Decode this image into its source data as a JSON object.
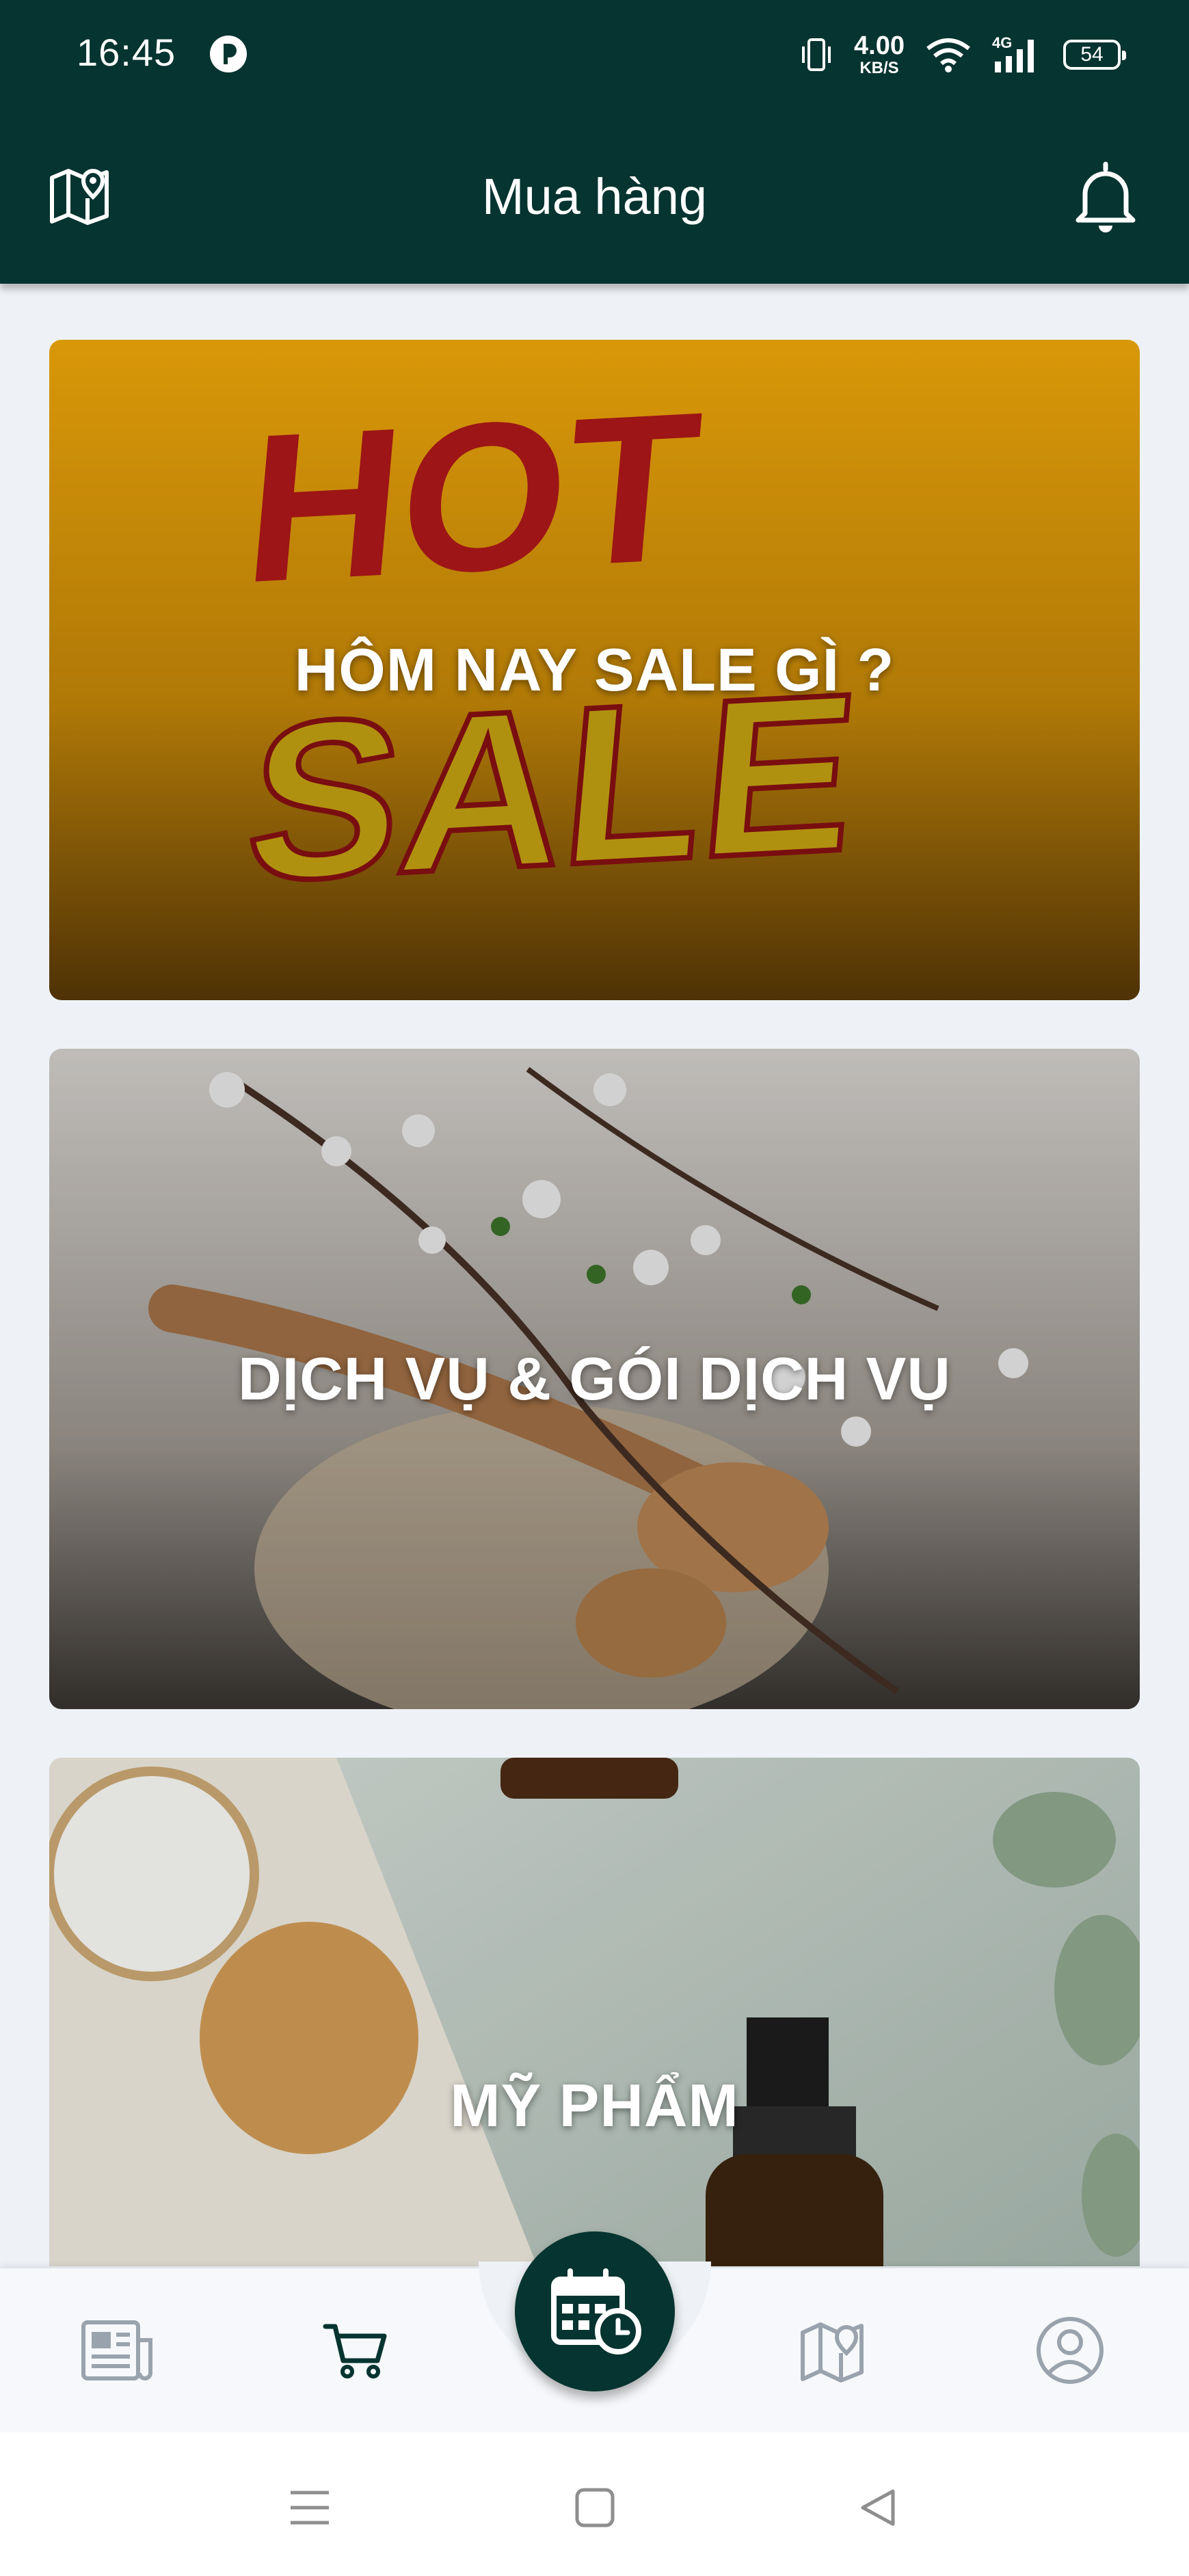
{
  "status_bar": {
    "time": "16:45",
    "net_speed_value": "4.00",
    "net_speed_unit": "KB/S",
    "network_label": "4G",
    "battery": "54",
    "icons": [
      "app-notification-icon",
      "vibrate-icon",
      "wifi-icon",
      "signal-icon",
      "battery-icon"
    ]
  },
  "app_bar": {
    "title": "Mua hàng",
    "left_icon": "map-pin-icon",
    "right_icon": "bell-icon"
  },
  "categories": [
    {
      "label": "HÔM NAY SALE GÌ ?",
      "image": "hot-sale-banner"
    },
    {
      "label": "DỊCH VỤ & GÓI DỊCH VỤ",
      "image": "spa-flowers-spoons"
    },
    {
      "label": "MỸ PHẨM",
      "image": "cosmetics-jars"
    }
  ],
  "bottom_nav": {
    "items": [
      "news-icon",
      "cart-icon",
      "calendar-clock-icon",
      "map-icon",
      "profile-icon"
    ],
    "active": "cart-icon"
  },
  "colors": {
    "primary": "#063430",
    "background": "#eef2f6",
    "inactive_icon": "#9aa3ad"
  }
}
